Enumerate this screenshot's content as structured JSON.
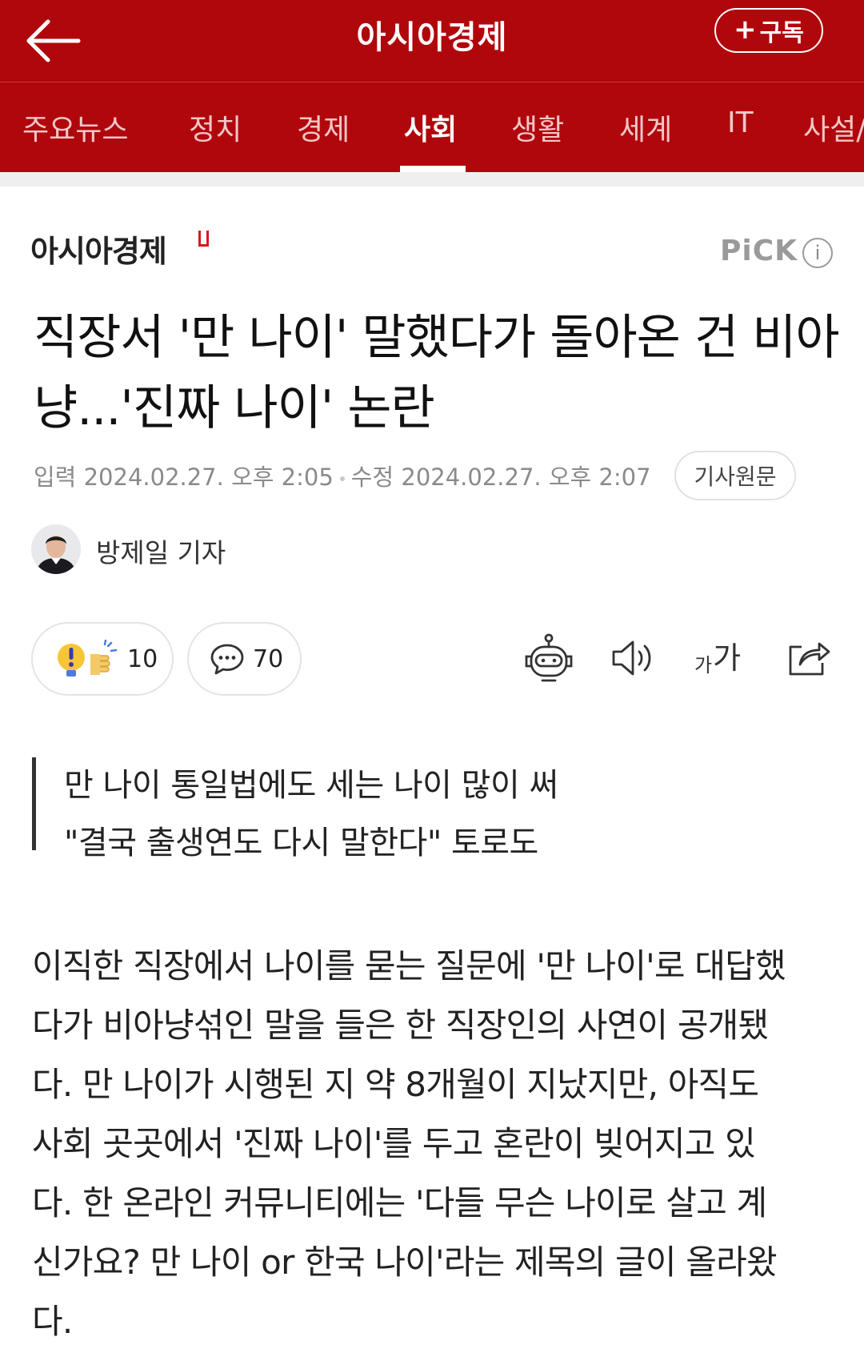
{
  "header": {
    "title": "아시아경제",
    "subscribe_label": "구독",
    "subscribe_plus": "+"
  },
  "nav": {
    "tabs": [
      {
        "label": "주요뉴스",
        "active": false
      },
      {
        "label": "정치",
        "active": false
      },
      {
        "label": "경제",
        "active": false
      },
      {
        "label": "사회",
        "active": true
      },
      {
        "label": "생활",
        "active": false
      },
      {
        "label": "세계",
        "active": false
      },
      {
        "label": "IT",
        "active": false
      },
      {
        "label": "사설/",
        "active": false
      }
    ]
  },
  "article": {
    "press_name": "아시아경제",
    "pick_label": "PiCK",
    "info_glyph": "i",
    "headline": "직장서 '만 나이' 말했다가 돌아온 건 비아냥...'진짜 나이' 논란",
    "input_label": "입력",
    "input_time": "2024.02.27. 오후 2:05",
    "modified_label": "수정",
    "modified_time": "2024.02.27. 오후 2:07",
    "original_button": "기사원문",
    "reporter": "방제일 기자",
    "reaction_count": "10",
    "comment_count": "70",
    "font_size_label_small": "가",
    "font_size_label_large": "가",
    "summary_lines": [
      "만 나이 통일법에도 세는 나이 많이 써",
      "\"결국 출생연도 다시 말한다\" 토로도"
    ],
    "body_lines": [
      "이직한 직장에서 나이를 묻는 질문에 '만 나이'로 대답했",
      "다가 비아냥섞인 말을 들은 한 직장인의 사연이 공개됐",
      "다. 만 나이가 시행된 지 약 8개월이 지났지만, 아직도",
      "사회 곳곳에서 '진짜 나이'를 두고 혼란이 빚어지고 있",
      "다. 한 온라인 커뮤니티에는 '다들 무슨 나이로 살고 계",
      "신가요? 만 나이 or 한국 나이'라는 제목의 글이 올라왔",
      "다."
    ]
  },
  "colors": {
    "brand_red": "#b0070c",
    "inactive_tab": "#f3c7c8",
    "meta_gray": "#8a8a8a"
  },
  "icons": {
    "back": "arrow-left-icon",
    "reaction": "exclamation-thumbs-icon",
    "comment": "speech-bubble-icon",
    "robot": "robot-icon",
    "speaker": "speaker-icon",
    "font_size": "font-size-icon",
    "share": "share-icon"
  }
}
